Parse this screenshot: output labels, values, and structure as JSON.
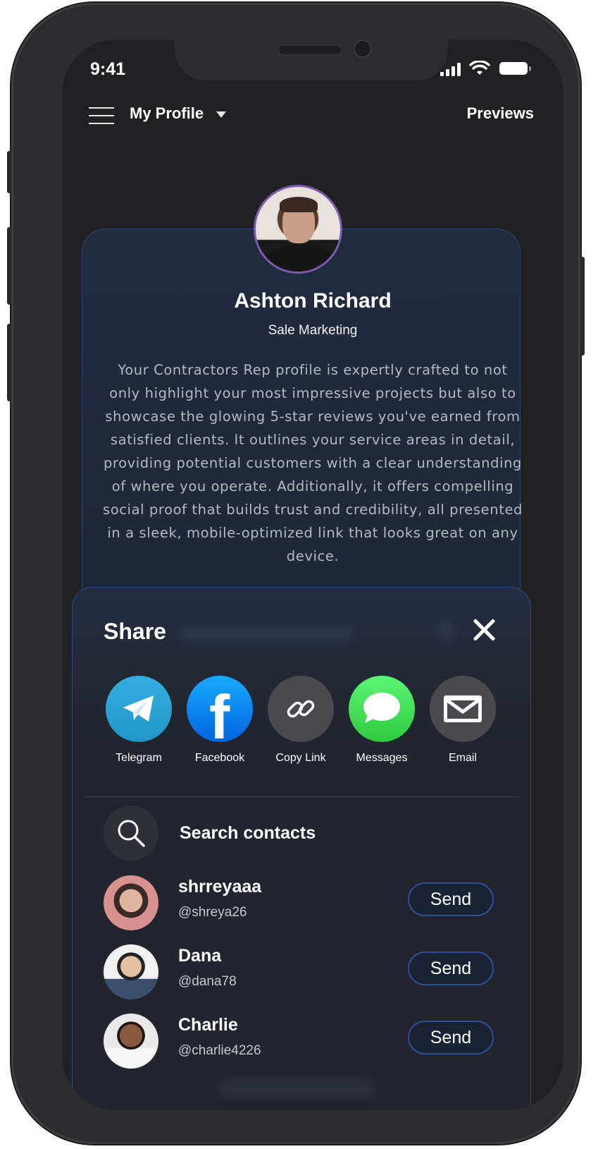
{
  "status_bar": {
    "time": "9:41"
  },
  "header": {
    "title": "My Profile",
    "previews_label": "Previews"
  },
  "profile": {
    "name": "Ashton Richard",
    "role": "Sale Marketing",
    "bio": "Your Contractors Rep profile is expertly crafted to not only highlight your most impressive projects but also to showcase the glowing 5-star reviews you've earned from satisfied clients. It outlines your service areas in detail, providing potential customers with a clear understanding of where you operate. Additionally, it offers compelling social proof that builds trust and credibility, all presented in a sleek, mobile-optimized link that looks great on any device."
  },
  "share_sheet": {
    "title": "Share",
    "targets": [
      {
        "label": "Telegram",
        "icon": "telegram-icon",
        "color": "#2aa3dd"
      },
      {
        "label": "Facebook",
        "icon": "facebook-icon",
        "color": "#1877f2"
      },
      {
        "label": "Copy Link",
        "icon": "link-icon",
        "color": "#4b4b4f"
      },
      {
        "label": "Messages",
        "icon": "messages-icon",
        "color": "#34c759"
      },
      {
        "label": "Email",
        "icon": "email-icon",
        "color": "#4b4b4f"
      }
    ],
    "search_label": "Search contacts",
    "contacts": [
      {
        "name": "shrreyaaa",
        "handle": "@shreya26",
        "action": "Send"
      },
      {
        "name": "Dana",
        "handle": "@dana78",
        "action": "Send"
      },
      {
        "name": "Charlie",
        "handle": "@charlie4226",
        "action": "Send"
      }
    ]
  },
  "colors": {
    "background": "#212124",
    "accent_border": "#2e4f98",
    "text": "#ffffff"
  }
}
